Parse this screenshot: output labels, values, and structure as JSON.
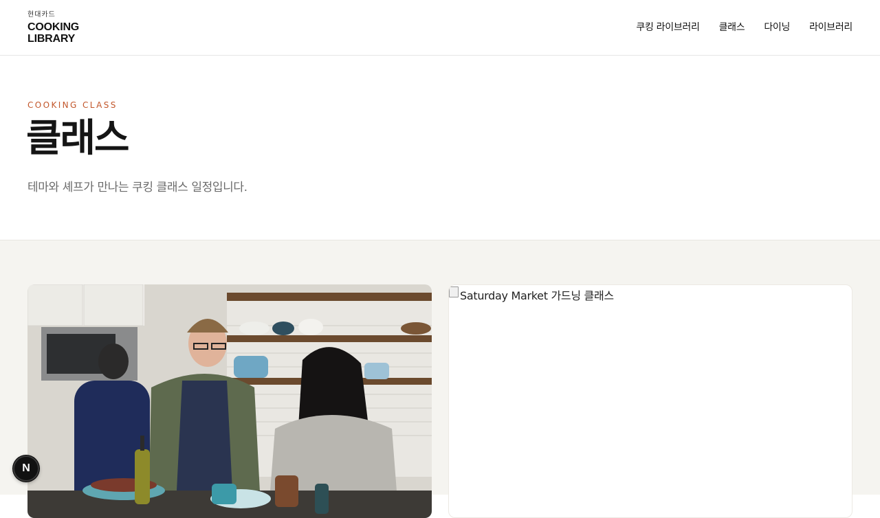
{
  "header": {
    "logo_small": "현대카드",
    "logo_main": "COOKING\nLIBRARY",
    "nav": [
      {
        "label": "쿠킹 라이브러리"
      },
      {
        "label": "클래스"
      },
      {
        "label": "다이닝"
      },
      {
        "label": "라이브러리"
      }
    ]
  },
  "hero": {
    "eyebrow": "COOKING CLASS",
    "title": "클래스",
    "description": "테마와 셰프가 만나는 쿠킹 클래스 일정입니다."
  },
  "cards": [
    {
      "image_alt": "",
      "image_subject": "kitchen-cooking-photo"
    },
    {
      "image_alt": "Saturday Market 가드닝 클래스"
    }
  ],
  "badge": {
    "label": "N"
  },
  "colors": {
    "accent": "#c2562a",
    "section_bg": "#f5f4f0"
  }
}
